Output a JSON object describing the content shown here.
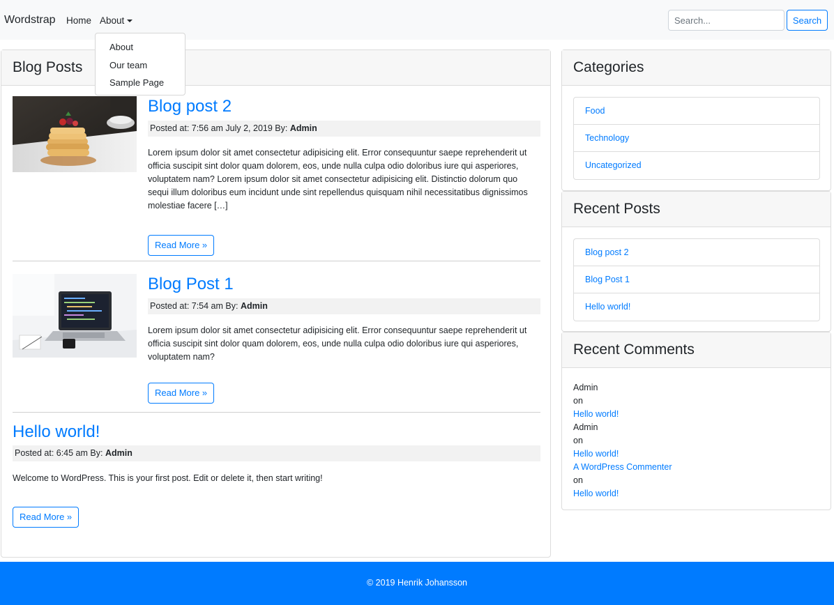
{
  "navbar": {
    "brand": "Wordstrap",
    "home": "Home",
    "about": "About",
    "search_placeholder": "Search...",
    "search_button": "Search"
  },
  "dropdown": {
    "items": [
      "About",
      "Our team",
      "Sample Page"
    ]
  },
  "main": {
    "header": "Blog Posts",
    "posts": [
      {
        "title": "Blog post 2",
        "posted_prefix": "Posted at: 7:56 am July 2, 2019 By: ",
        "author": "Admin",
        "excerpt": "Lorem ipsum dolor sit amet consectetur adipisicing elit. Error consequuntur saepe reprehenderit ut officia suscipit sint dolor quam dolorem, eos, unde nulla culpa odio doloribus iure qui asperiores, voluptatem nam? Lorem ipsum dolor sit amet consectetur adipisicing elit. Distinctio dolorum quo sequi illum doloribus eum incidunt unde sint repellendus quisquam nihil necessitatibus dignissimos molestiae facere […]",
        "read_more": "Read More »",
        "image": "pancakes-photo"
      },
      {
        "title": "Blog Post 1",
        "posted_prefix": "Posted at: 7:54 am By: ",
        "author": "Admin",
        "excerpt": "Lorem ipsum dolor sit amet consectetur adipisicing elit. Error consequuntur saepe reprehenderit ut officia suscipit sint dolor quam dolorem, eos, unde nulla culpa odio doloribus iure qui asperiores, voluptatem nam?",
        "read_more": "Read More »",
        "image": "laptop-photo"
      },
      {
        "title": "Hello world!",
        "posted_prefix": "Posted at: 6:45 am By: ",
        "author": "Admin",
        "excerpt": "Welcome to WordPress. This is your first post. Edit or delete it, then start writing!",
        "read_more": "Read More »"
      }
    ]
  },
  "sidebar": {
    "categories": {
      "title": "Categories",
      "items": [
        "Food",
        "Technology",
        "Uncategorized"
      ]
    },
    "recent_posts": {
      "title": "Recent Posts",
      "items": [
        "Blog post 2",
        "Blog Post 1",
        "Hello world!"
      ]
    },
    "recent_comments": {
      "title": "Recent Comments",
      "items": [
        {
          "author": "Admin",
          "on": "on",
          "post": "Hello world!"
        },
        {
          "author": "Admin",
          "on": "on",
          "post": "Hello world!"
        },
        {
          "author": "A WordPress Commenter",
          "on": "on",
          "post": "Hello world!"
        }
      ]
    }
  },
  "footer": {
    "text": "© 2019 Henrik Johansson"
  },
  "colors": {
    "accent": "#007bff",
    "navbar_bg": "#f8f9fa",
    "card_header_bg": "#f7f7f7"
  }
}
